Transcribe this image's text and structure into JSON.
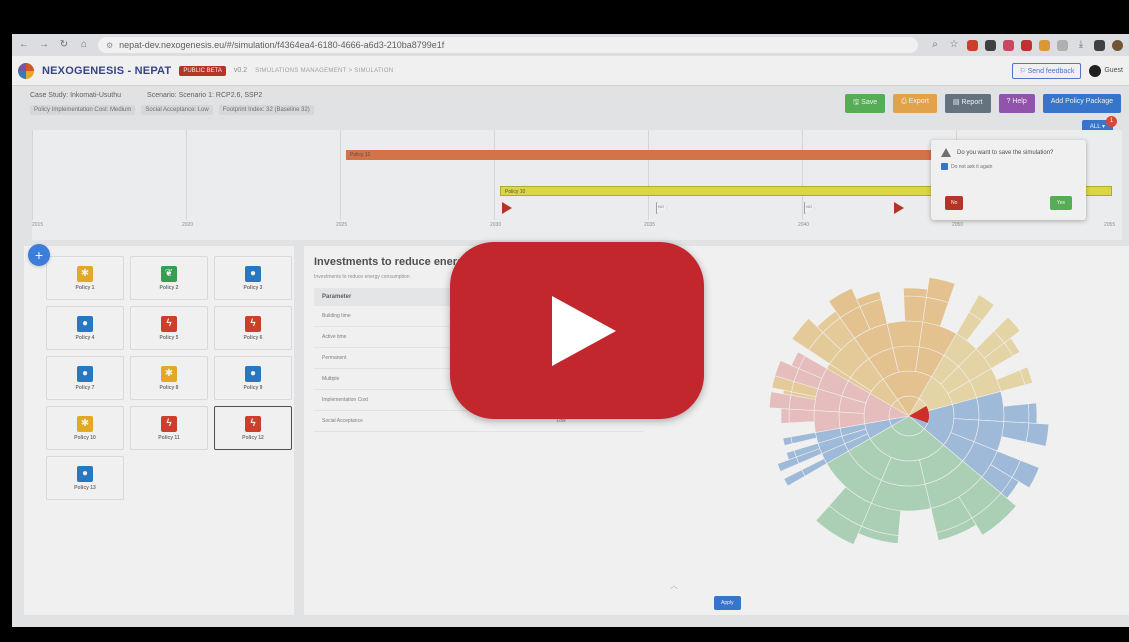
{
  "browser": {
    "url": "nepat-dev.nexogenesis.eu/#/simulation/f4364ea4-6180-4666-a6d3-210ba8799e1f"
  },
  "header": {
    "brand": "NEXOGENESIS - NEPAT",
    "badge": "PUBLIC BETA",
    "version": "v0.2",
    "breadcrumb": "SIMULATIONS MANAGEMENT  >  SIMULATION",
    "feedback": "Send feedback",
    "user": "Guest"
  },
  "info": {
    "case_study": "Case Study: Inkomati-Usuthu",
    "scenario": "Scenario: Scenario 1: RCP2.6, SSP2",
    "tags": [
      "Policy Implementation Cost: Medium",
      "Social Acceptance: Low",
      "Footprint Index: 32 (Baseline 32)"
    ],
    "actions": {
      "save": "Save",
      "export": "Export",
      "report": "Report",
      "help": "? Help",
      "add_policy": "Add Policy Package"
    },
    "all_select": "ALL",
    "notifications": "1"
  },
  "timeline": {
    "years": [
      "2015",
      "2020",
      "2025",
      "2030",
      "2035",
      "2040",
      "2045",
      "2050",
      "2055"
    ],
    "bars": [
      {
        "label": "Policy 12",
        "color": "#e07b4f"
      },
      {
        "label": "Policy 10",
        "color": "#e9e44a"
      }
    ],
    "markers": [
      "NO",
      "NO"
    ]
  },
  "dialog": {
    "question": "Do you want to save the simulation?",
    "checkbox": "Do not ask it again",
    "no": "No",
    "yes": "Yes"
  },
  "policies": [
    {
      "label": "Policy 1",
      "icon": "windmill-icon",
      "symbol": "✱",
      "cls": "pi-yellow"
    },
    {
      "label": "Policy 2",
      "icon": "leaf-icon",
      "symbol": "❦",
      "cls": "pi-green"
    },
    {
      "label": "Policy 3",
      "icon": "water-drop-icon",
      "symbol": "●",
      "cls": "pi-blue"
    },
    {
      "label": "Policy 4",
      "icon": "water-drop-icon",
      "symbol": "●",
      "cls": "pi-blue"
    },
    {
      "label": "Policy 5",
      "icon": "lightning-icon",
      "symbol": "ϟ",
      "cls": "pi-red"
    },
    {
      "label": "Policy 6",
      "icon": "lightning-icon",
      "symbol": "ϟ",
      "cls": "pi-red"
    },
    {
      "label": "Policy 7",
      "icon": "water-drop-icon",
      "symbol": "●",
      "cls": "pi-blue"
    },
    {
      "label": "Policy 8",
      "icon": "windmill-icon",
      "symbol": "✱",
      "cls": "pi-yellow"
    },
    {
      "label": "Policy 9",
      "icon": "water-drop-icon",
      "symbol": "●",
      "cls": "pi-blue"
    },
    {
      "label": "Policy 10",
      "icon": "windmill-icon",
      "symbol": "✱",
      "cls": "pi-yellow"
    },
    {
      "label": "Policy 11",
      "icon": "lightning-icon",
      "symbol": "ϟ",
      "cls": "pi-red"
    },
    {
      "label": "Policy 12",
      "icon": "lightning-icon",
      "symbol": "ϟ",
      "cls": "pi-red",
      "selected": true
    },
    {
      "label": "Policy 13",
      "icon": "water-drop-icon",
      "symbol": "●",
      "cls": "pi-blue"
    }
  ],
  "detail": {
    "title": "Investments to reduce energy c",
    "subtitle": "Investments to reduce energy consumption",
    "param_header": "Parameter",
    "rows": [
      {
        "param": "Building time",
        "value": ""
      },
      {
        "param": "Active time",
        "value": ""
      },
      {
        "param": "Permanent",
        "value": ""
      },
      {
        "param": "Multiple",
        "value": ""
      },
      {
        "param": "Implementation Cost",
        "value": ""
      },
      {
        "param": "Social Acceptance",
        "value": "Low"
      }
    ],
    "apply": "Apply"
  },
  "colors": {
    "accent": "#3b7dd8",
    "play": "#c2272d"
  }
}
